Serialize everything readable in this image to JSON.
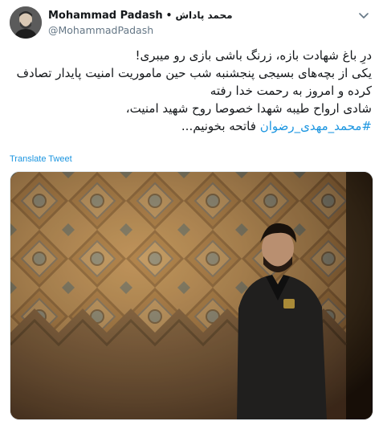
{
  "author": {
    "display_name": "Mohammad Padash",
    "name_suffix": "• محمد پاداش",
    "handle": "@MohammadPadash"
  },
  "tweet": {
    "lines": [
      "درِ باغ شهادت بازه، زرنگ باشی بازی رو میبری!",
      "یکی از بچه‌های بسیجی پنجشنبه شب حین ماموریت امنیت پایدار تصادف",
      "کرده و امروز به رحمت خدا رفته",
      "شادی ارواح طیبه شهدا خصوصا روح شهید امنیت،"
    ],
    "hashtag": "#محمد_مهدی_رضوان",
    "last_line_rest": " فاتحه بخونیم..."
  },
  "translate_label": "Translate Tweet",
  "icons": {
    "avatar": "user-avatar",
    "caret": "chevron-down-icon"
  },
  "colors": {
    "link": "#1b95e0",
    "handle": "#657786"
  }
}
